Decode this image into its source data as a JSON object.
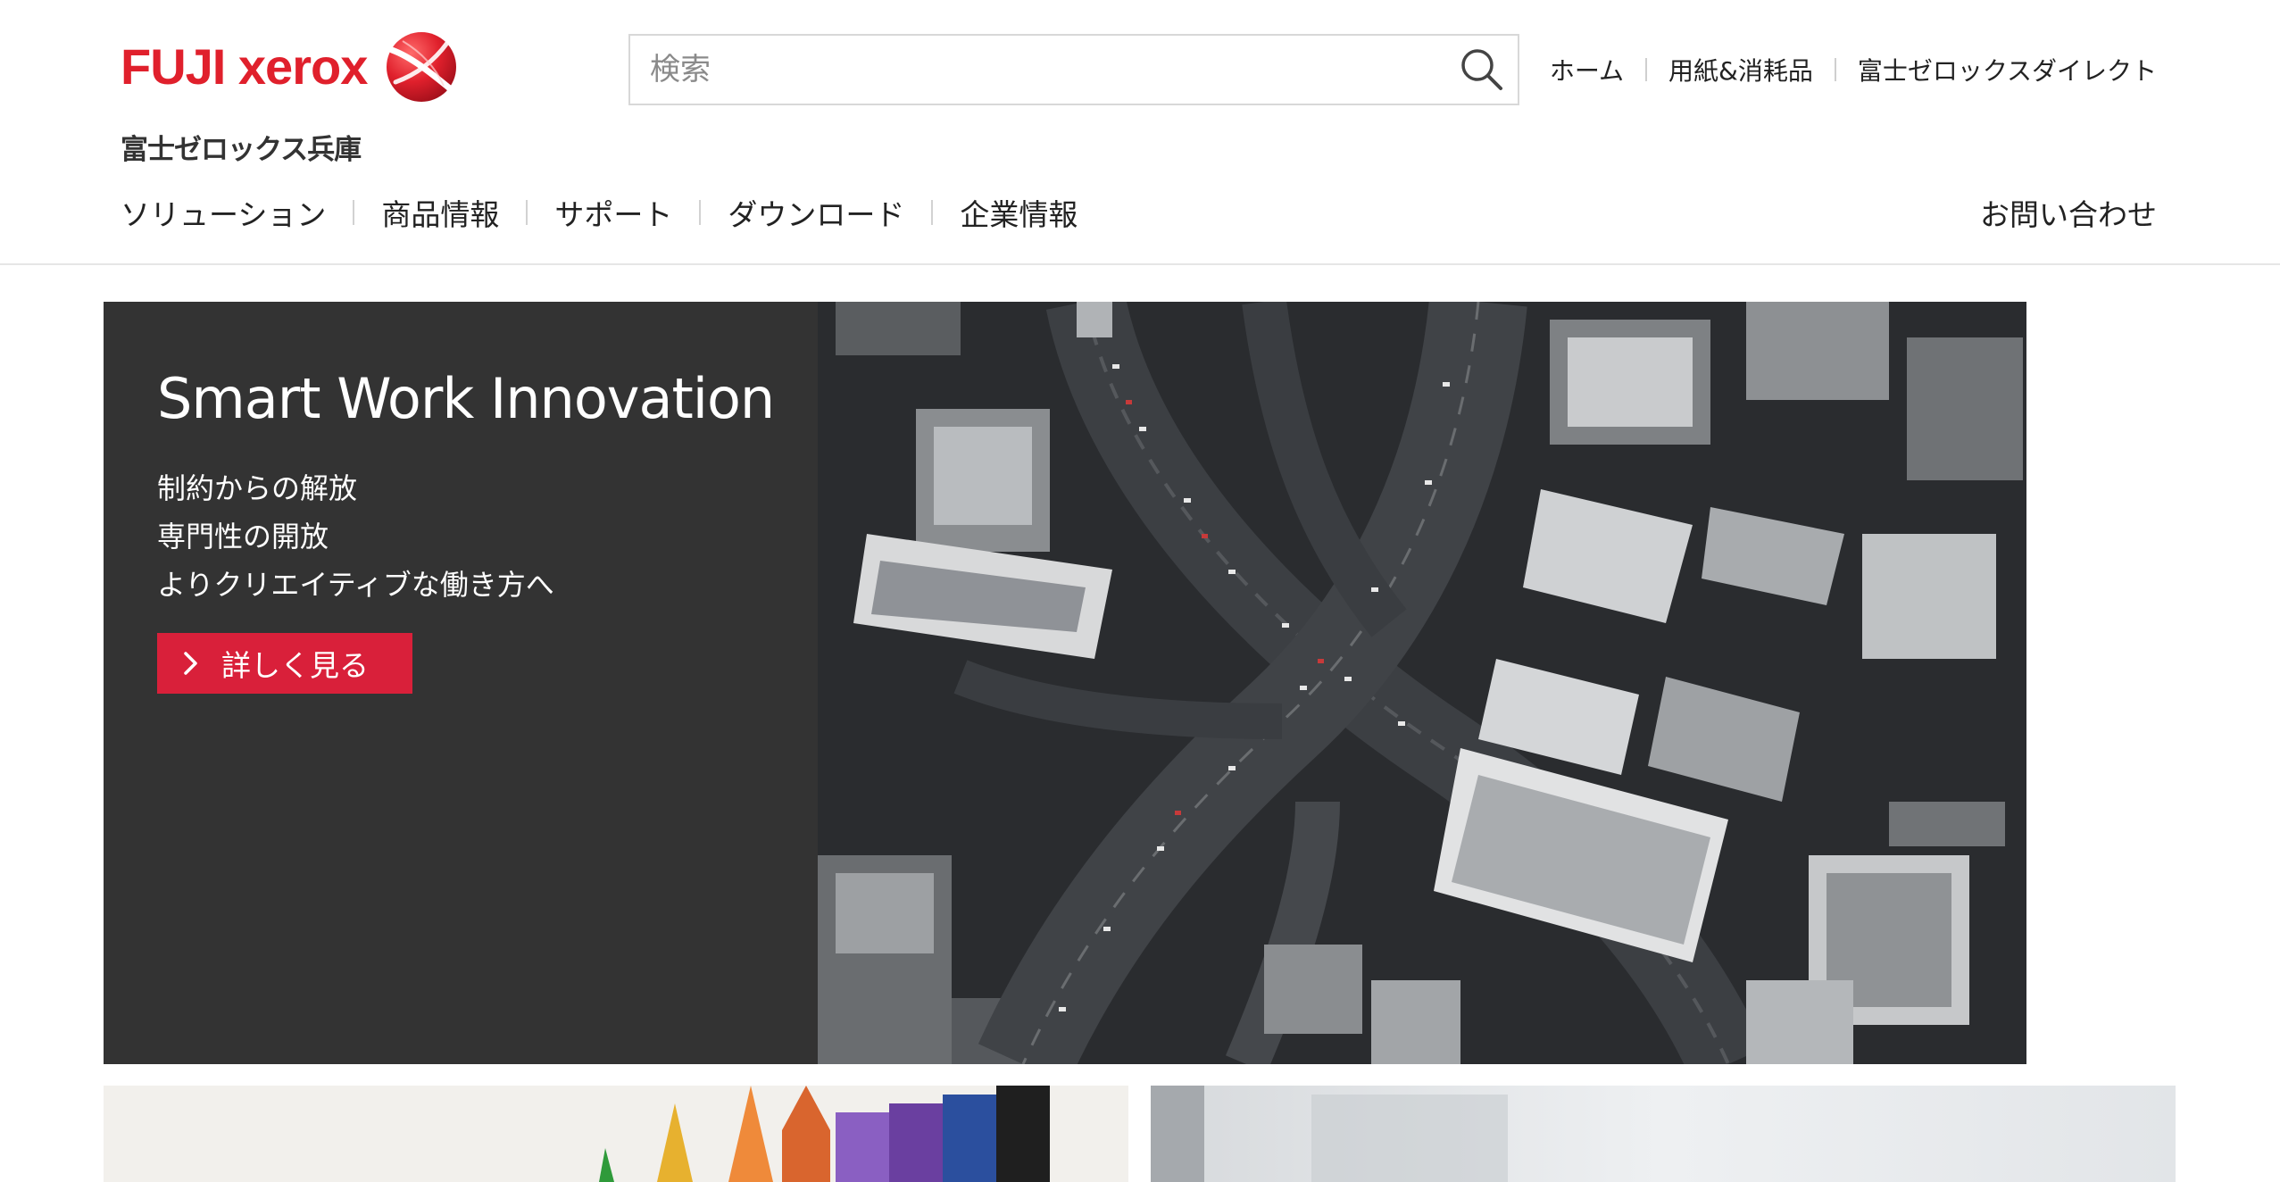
{
  "header": {
    "logo_text": "FUJI xerox",
    "sub_brand": "富士ゼロックス兵庫",
    "search_placeholder": "検索",
    "util_links": [
      "ホーム",
      "用紙&消耗品",
      "富士ゼロックスダイレクト"
    ],
    "main_nav": [
      "ソリューション",
      "商品情報",
      "サポート",
      "ダウンロード",
      "企業情報"
    ],
    "contact": "お問い合わせ"
  },
  "hero": {
    "title": "Smart Work Innovation",
    "lines": [
      "制約からの解放",
      "専門性の開放",
      "よりクリエイティブな働き方へ"
    ],
    "button_label": "詳しく見る"
  },
  "colors": {
    "brand_red": "#e0202c",
    "button_red": "#d9203a",
    "hero_panel": "#333333"
  }
}
